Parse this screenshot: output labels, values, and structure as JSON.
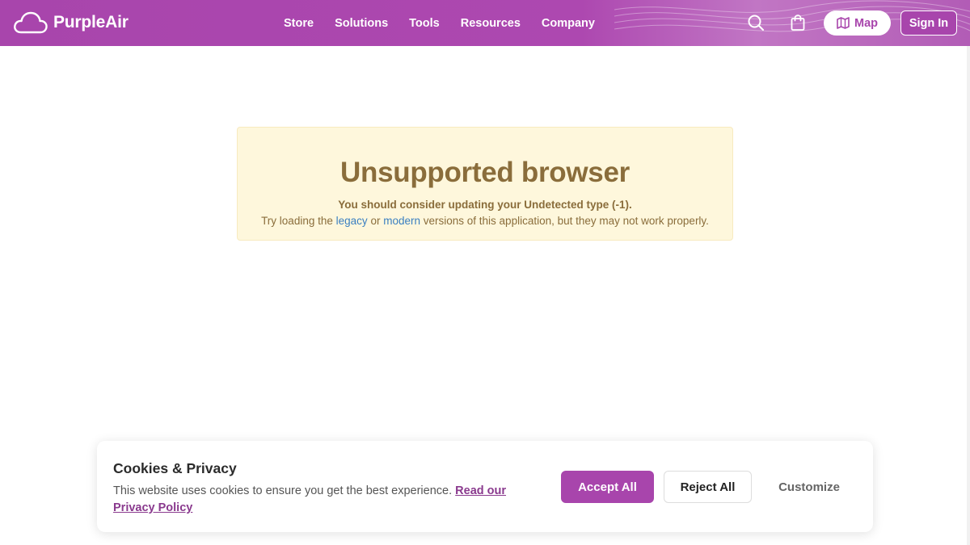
{
  "header": {
    "brand": "PurpleAir",
    "nav": [
      "Store",
      "Solutions",
      "Tools",
      "Resources",
      "Company"
    ],
    "icons": {
      "logo": "cloud-icon",
      "search": "search-icon",
      "cart": "shopping-bag-icon",
      "map": "map-icon"
    },
    "map_label": "Map",
    "signin_label": "Sign In"
  },
  "alert": {
    "title": "Unsupported browser",
    "line1": "You should consider updating your Undetected type (-1).",
    "line2_prefix": "Try loading the",
    "legacy_link": "legacy",
    "line2_or": "or",
    "modern_link": "modern",
    "line2_suffix": "versions of this application, but they may not work properly."
  },
  "cookie": {
    "title": "Cookies & Privacy",
    "text": "This website uses cookies to ensure you get the best experience.",
    "policy_link": "Read our Privacy Policy",
    "accept_label": "Accept All",
    "reject_label": "Reject All",
    "customize_label": "Customize"
  },
  "colors": {
    "brand_purple": "#a845ac",
    "alert_bg": "#fef7dc",
    "alert_text": "#8a6d3b",
    "link_blue": "#3a7fc1"
  }
}
